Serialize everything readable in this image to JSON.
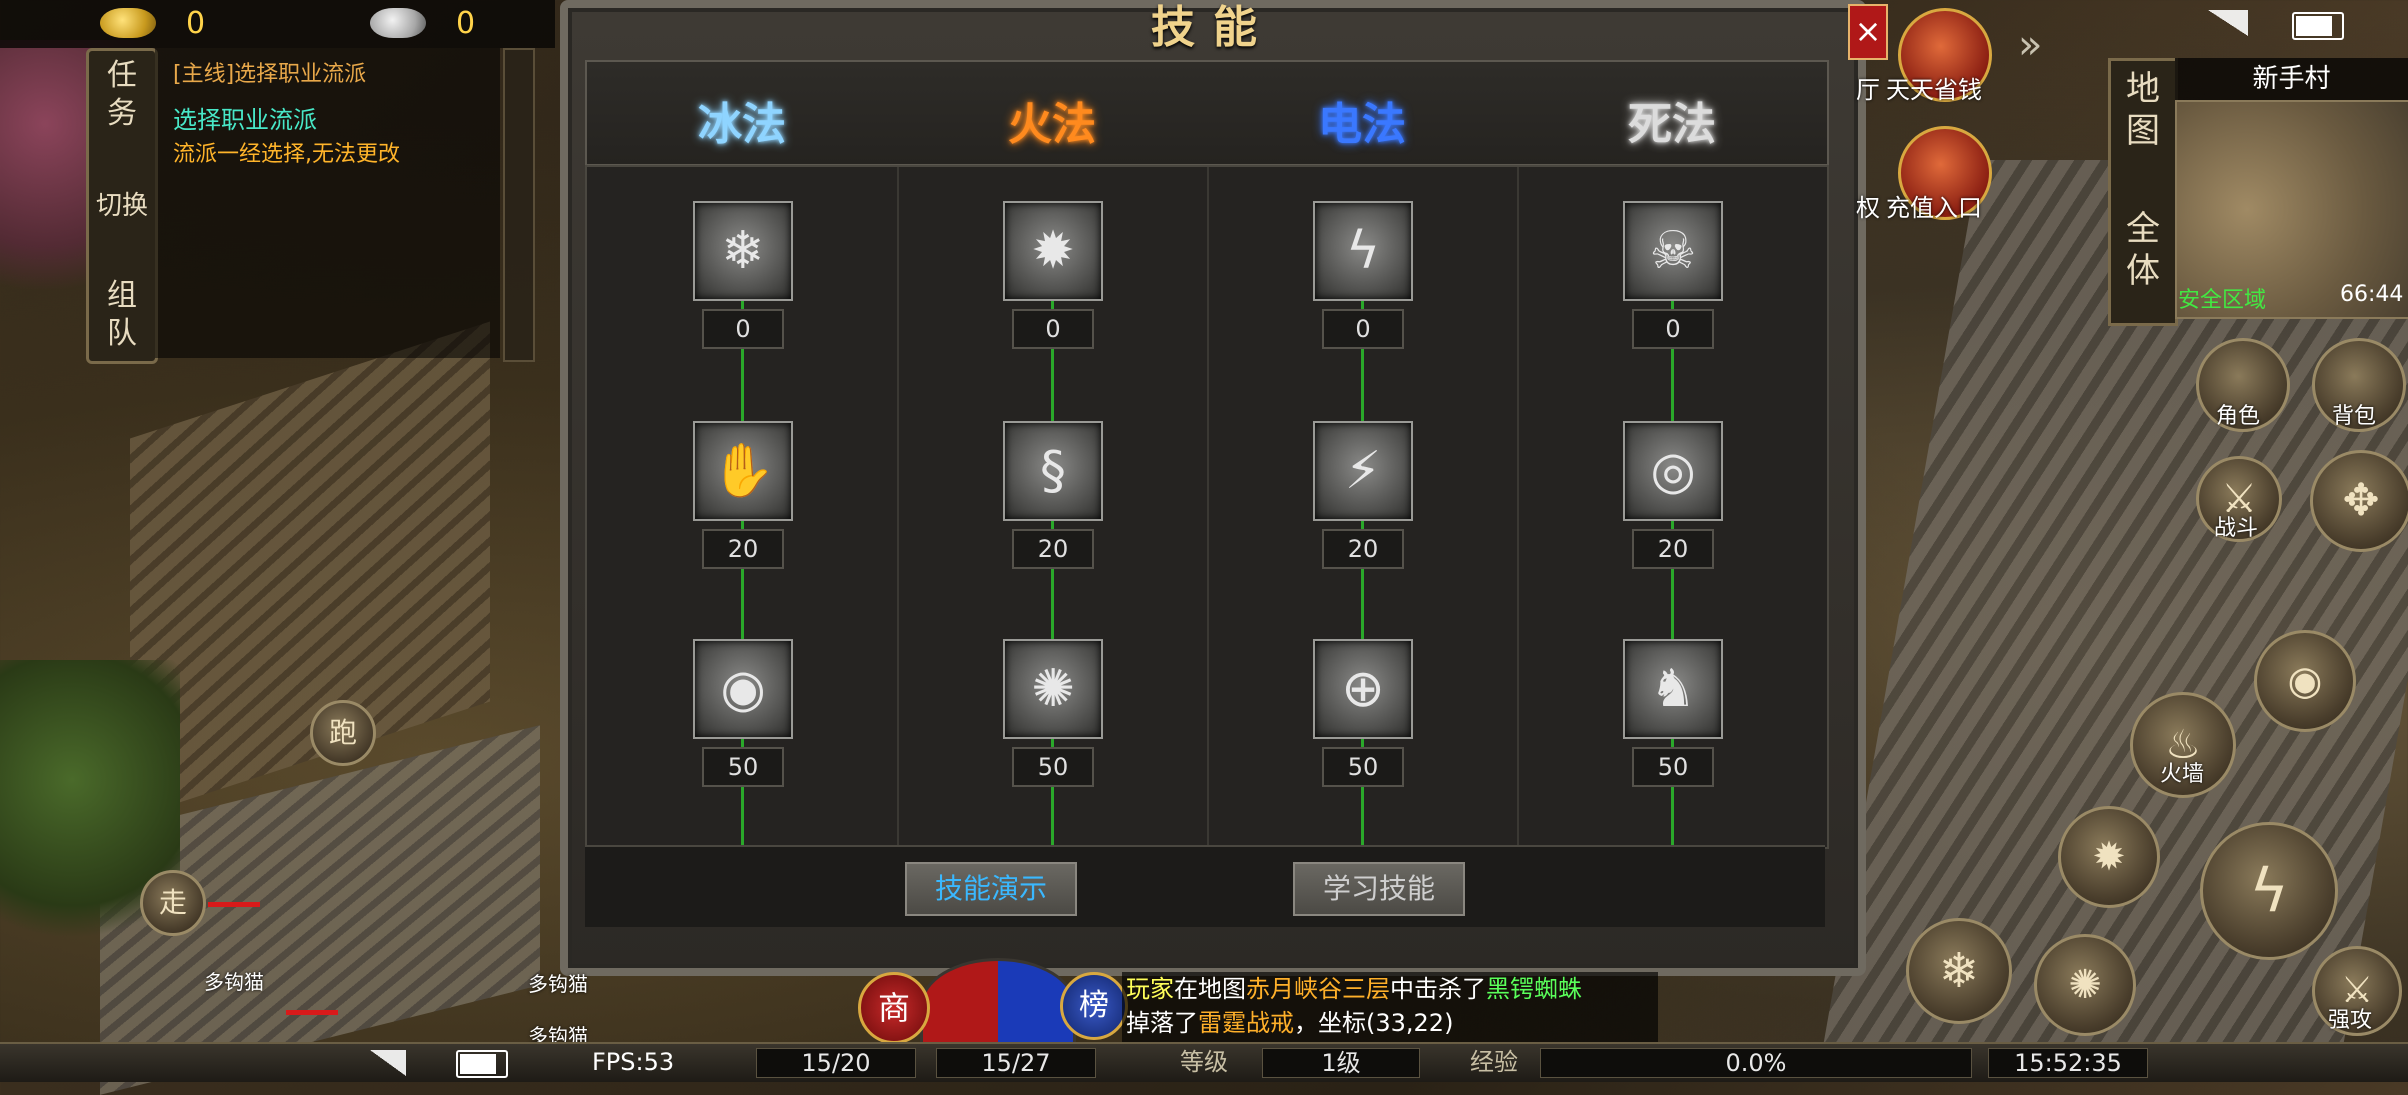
{
  "currency": {
    "gold": "0",
    "silver": "0"
  },
  "quest": {
    "tabs": [
      "任",
      "务",
      "切换",
      "组",
      "队"
    ],
    "title": "[主线]选择职业流派",
    "objective": "选择职业流派",
    "note": "流派一经选择,无法更改"
  },
  "window": {
    "title": "技能",
    "close_label": "×",
    "schools": [
      {
        "label": "冰法",
        "color": "#8fd4ff"
      },
      {
        "label": "火法",
        "color": "#ff8a1e"
      },
      {
        "label": "电法",
        "color": "#3a78ff"
      },
      {
        "label": "死法",
        "color": "#dcdcdc"
      }
    ],
    "skills": [
      [
        {
          "icon": "ice-orb-icon",
          "glyph": "❄",
          "level": "0"
        },
        {
          "icon": "ice-hand-icon",
          "glyph": "✋",
          "level": "20"
        },
        {
          "icon": "ice-shield-icon",
          "glyph": "◉",
          "level": "50"
        }
      ],
      [
        {
          "icon": "fire-burst-icon",
          "glyph": "✹",
          "level": "0"
        },
        {
          "icon": "fire-swirl-icon",
          "glyph": "§",
          "level": "20"
        },
        {
          "icon": "fire-rain-icon",
          "glyph": "✺",
          "level": "50"
        }
      ],
      [
        {
          "icon": "lightning-bolt-icon",
          "glyph": "ϟ",
          "level": "0"
        },
        {
          "icon": "lightning-staff-icon",
          "glyph": "⚡",
          "level": "20"
        },
        {
          "icon": "lightning-shield-icon",
          "glyph": "⊕",
          "level": "50"
        }
      ],
      [
        {
          "icon": "skull-icon",
          "glyph": "☠",
          "level": "0"
        },
        {
          "icon": "eye-icon",
          "glyph": "◎",
          "level": "20"
        },
        {
          "icon": "summon-beast-icon",
          "glyph": "♞",
          "level": "50"
        }
      ]
    ],
    "btn_demo": "技能演示",
    "btn_learn": "学习技能"
  },
  "events": [
    {
      "label": "天天省钱"
    },
    {
      "label": "充值入口"
    }
  ],
  "event_partials": [
    "厅",
    "权"
  ],
  "map": {
    "tabs": [
      "地",
      "图",
      "全",
      "体"
    ],
    "location": "新手村",
    "zone": "安全区域",
    "clock": "66:44"
  },
  "right_buttons": {
    "character": "角色",
    "bag": "背包",
    "battle": "战斗",
    "fire_wall": "火墙",
    "strong_attack": "强攻"
  },
  "left_buttons": {
    "run": "跑",
    "walk": "走"
  },
  "name_tags": [
    "多钩猫",
    "多钩猫",
    "多钩猫"
  ],
  "chat": {
    "shop": "商",
    "rank": "榜",
    "line1": [
      {
        "text": "玩家",
        "color": "#ffff5a"
      },
      {
        "text": "在地图",
        "color": "#ffffff"
      },
      {
        "text": "赤月峡谷三层",
        "color": "#ffb02a"
      },
      {
        "text": "中击杀了",
        "color": "#ffffff"
      },
      {
        "text": "黑锷蜘蛛",
        "color": "#5aff5a"
      }
    ],
    "line2": [
      {
        "text": "掉落了",
        "color": "#ffffff"
      },
      {
        "text": "雷霆战戒",
        "color": "#ffb02a"
      },
      {
        "text": "，坐标(33,22)",
        "color": "#ffffff"
      }
    ]
  },
  "bottom_bar": {
    "fps": "FPS:53",
    "hp": "15/20",
    "mp": "15/27",
    "level_label": "等级",
    "level": "1级",
    "exp_label": "经验",
    "exp": "0.0%",
    "exp_fraction": 0.0,
    "time": "15:52:35"
  }
}
